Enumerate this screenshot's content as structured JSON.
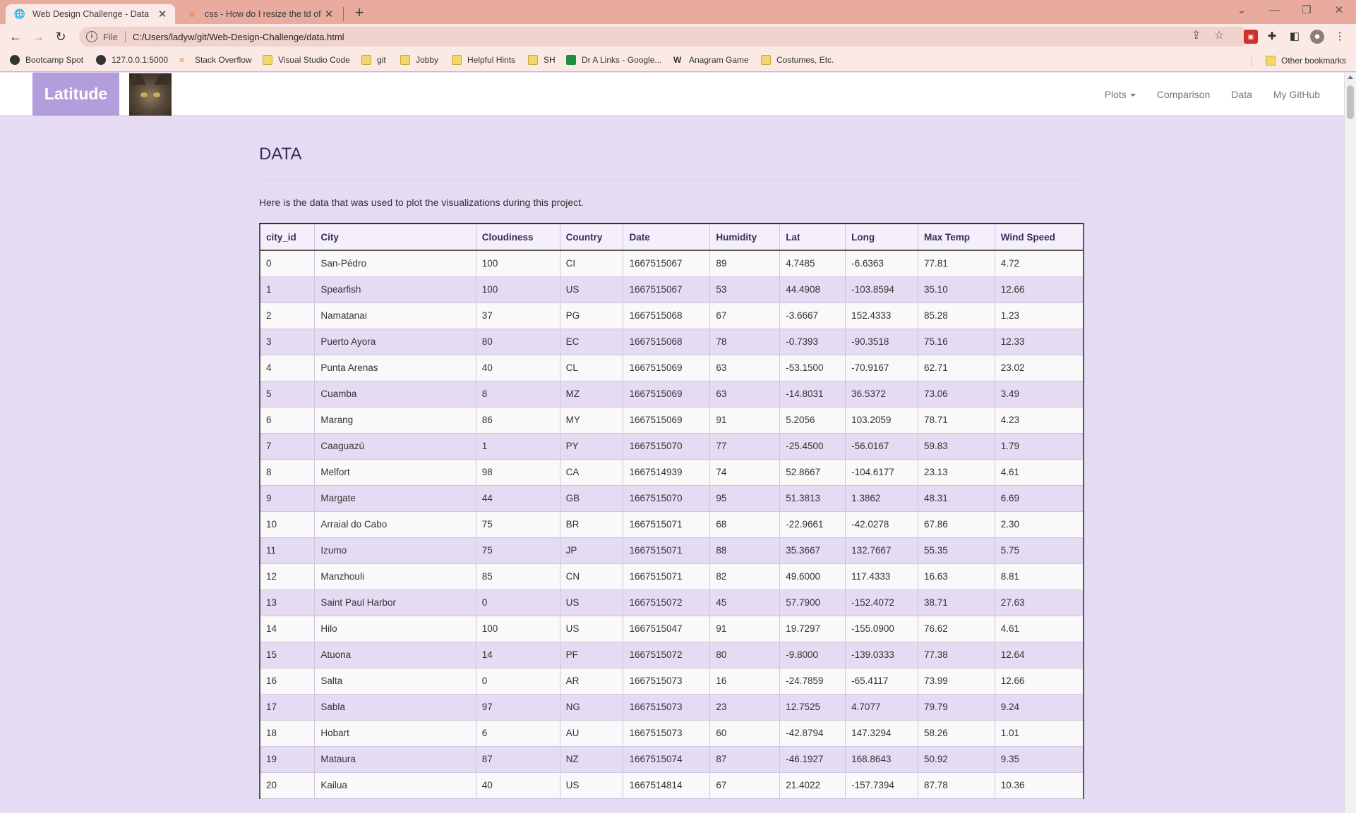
{
  "browser": {
    "tabs": [
      {
        "title": "Web Design Challenge - Data",
        "active": true,
        "icon": "globe-icon"
      },
      {
        "title": "css - How do I resize the td of a",
        "active": false,
        "icon": "stack-overflow-icon"
      }
    ],
    "new_tab": "+",
    "address": {
      "scheme_label": "File",
      "url": "C:/Users/ladyw/git/Web-Design-Challenge/data.html"
    },
    "bookmarks": [
      {
        "label": "Bootcamp Spot",
        "icon": "globe-icon"
      },
      {
        "label": "127.0.0.1:5000",
        "icon": "globe-icon"
      },
      {
        "label": "Stack Overflow",
        "icon": "stack-overflow-icon"
      },
      {
        "label": "Visual Studio Code",
        "icon": "folder-icon"
      },
      {
        "label": "git",
        "icon": "folder-icon"
      },
      {
        "label": "Jobby",
        "icon": "folder-icon"
      },
      {
        "label": "Helpful Hints",
        "icon": "folder-icon"
      },
      {
        "label": "SH",
        "icon": "folder-icon"
      },
      {
        "label": "Dr A Links - Google...",
        "icon": "sheets-icon"
      },
      {
        "label": "Anagram Game",
        "icon": "w-icon"
      },
      {
        "label": "Costumes, Etc.",
        "icon": "folder-icon"
      }
    ],
    "other_bookmarks": "Other bookmarks"
  },
  "site": {
    "brand": "Latitude",
    "nav": {
      "plots": "Plots",
      "comparison": "Comparison",
      "data": "Data",
      "github": "My GitHub"
    },
    "heading": "DATA",
    "lead": "Here is the data that was used to plot the visualizations during this project."
  },
  "table": {
    "headers": [
      "city_id",
      "City",
      "Cloudiness",
      "Country",
      "Date",
      "Humidity",
      "Lat",
      "Long",
      "Max Temp",
      "Wind Speed"
    ],
    "rows": [
      [
        "0",
        "San-Pédro",
        "100",
        "CI",
        "1667515067",
        "89",
        "4.7485",
        "-6.6363",
        "77.81",
        "4.72"
      ],
      [
        "1",
        "Spearfish",
        "100",
        "US",
        "1667515067",
        "53",
        "44.4908",
        "-103.8594",
        "35.10",
        "12.66"
      ],
      [
        "2",
        "Namatanai",
        "37",
        "PG",
        "1667515068",
        "67",
        "-3.6667",
        "152.4333",
        "85.28",
        "1.23"
      ],
      [
        "3",
        "Puerto Ayora",
        "80",
        "EC",
        "1667515068",
        "78",
        "-0.7393",
        "-90.3518",
        "75.16",
        "12.33"
      ],
      [
        "4",
        "Punta Arenas",
        "40",
        "CL",
        "1667515069",
        "63",
        "-53.1500",
        "-70.9167",
        "62.71",
        "23.02"
      ],
      [
        "5",
        "Cuamba",
        "8",
        "MZ",
        "1667515069",
        "63",
        "-14.8031",
        "36.5372",
        "73.06",
        "3.49"
      ],
      [
        "6",
        "Marang",
        "86",
        "MY",
        "1667515069",
        "91",
        "5.2056",
        "103.2059",
        "78.71",
        "4.23"
      ],
      [
        "7",
        "Caaguazú",
        "1",
        "PY",
        "1667515070",
        "77",
        "-25.4500",
        "-56.0167",
        "59.83",
        "1.79"
      ],
      [
        "8",
        "Melfort",
        "98",
        "CA",
        "1667514939",
        "74",
        "52.8667",
        "-104.6177",
        "23.13",
        "4.61"
      ],
      [
        "9",
        "Margate",
        "44",
        "GB",
        "1667515070",
        "95",
        "51.3813",
        "1.3862",
        "48.31",
        "6.69"
      ],
      [
        "10",
        "Arraial do Cabo",
        "75",
        "BR",
        "1667515071",
        "68",
        "-22.9661",
        "-42.0278",
        "67.86",
        "2.30"
      ],
      [
        "11",
        "Izumo",
        "75",
        "JP",
        "1667515071",
        "88",
        "35.3667",
        "132.7667",
        "55.35",
        "5.75"
      ],
      [
        "12",
        "Manzhouli",
        "85",
        "CN",
        "1667515071",
        "82",
        "49.6000",
        "117.4333",
        "16.63",
        "8.81"
      ],
      [
        "13",
        "Saint Paul Harbor",
        "0",
        "US",
        "1667515072",
        "45",
        "57.7900",
        "-152.4072",
        "38.71",
        "27.63"
      ],
      [
        "14",
        "Hilo",
        "100",
        "US",
        "1667515047",
        "91",
        "19.7297",
        "-155.0900",
        "76.62",
        "4.61"
      ],
      [
        "15",
        "Atuona",
        "14",
        "PF",
        "1667515072",
        "80",
        "-9.8000",
        "-139.0333",
        "77.38",
        "12.64"
      ],
      [
        "16",
        "Salta",
        "0",
        "AR",
        "1667515073",
        "16",
        "-24.7859",
        "-65.4117",
        "73.99",
        "12.66"
      ],
      [
        "17",
        "Sabla",
        "97",
        "NG",
        "1667515073",
        "23",
        "12.7525",
        "4.7077",
        "79.79",
        "9.24"
      ],
      [
        "18",
        "Hobart",
        "6",
        "AU",
        "1667515073",
        "60",
        "-42.8794",
        "147.3294",
        "58.26",
        "1.01"
      ],
      [
        "19",
        "Mataura",
        "87",
        "NZ",
        "1667515074",
        "87",
        "-46.1927",
        "168.8643",
        "50.92",
        "9.35"
      ],
      [
        "20",
        "Kailua",
        "40",
        "US",
        "1667514814",
        "67",
        "21.4022",
        "-157.7394",
        "87.78",
        "10.36"
      ]
    ]
  },
  "colors": {
    "brand_bg": "#b39ddb",
    "page_bg": "#e5dcf4",
    "tabstrip": "#e8ab9e"
  }
}
